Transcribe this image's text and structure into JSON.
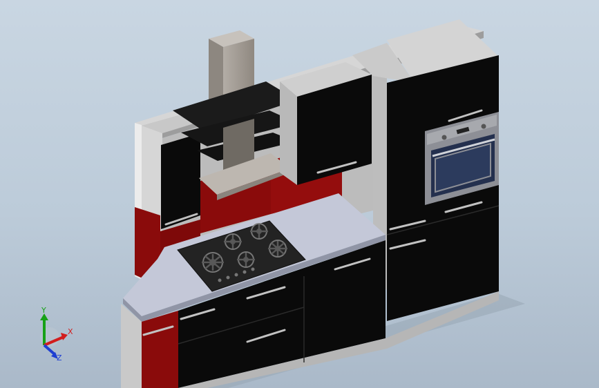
{
  "viewport": {
    "background_top": "#c9d6e2",
    "background_bottom": "#aab9c9"
  },
  "model": {
    "subject": "kitchen-cabinet-assembly",
    "colors": {
      "cabinet_black": "#0a0a0a",
      "side_panel_grey": "#b8b8b8",
      "side_panel_light": "#d6d6d6",
      "accent_red": "#8a0b0b",
      "countertop": "#c4c8d8",
      "hob": "#232323",
      "hood_steel": "#a39c94",
      "glass_shelf": "#1b1b1b",
      "oven_frame": "#8d8f96",
      "oven_door": "#24304e"
    }
  },
  "triad": {
    "x_label": "X",
    "y_label": "Y",
    "z_label": "Z",
    "x_color": "#d21d1d",
    "y_color": "#17a117",
    "z_color": "#1f3fd2"
  }
}
